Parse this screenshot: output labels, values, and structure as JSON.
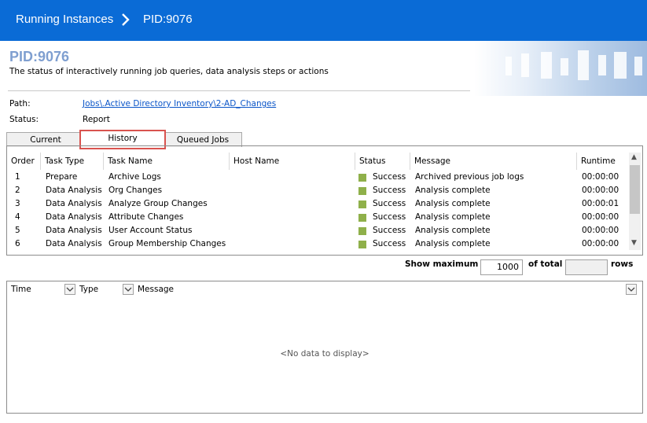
{
  "topbar": {
    "crumb_parent": "Running Instances",
    "crumb_current": "PID:9076"
  },
  "header": {
    "title": "PID:9076",
    "subtitle": "The status of interactively running job queries, data analysis steps or actions"
  },
  "info": {
    "path_label": "Path:",
    "path_value": "Jobs\\.Active Directory Inventory\\2-AD_Changes",
    "status_label": "Status:",
    "status_value": "Report"
  },
  "tabs": [
    {
      "label": "Current"
    },
    {
      "label": "History",
      "active": true
    },
    {
      "label": "Queued Jobs"
    }
  ],
  "table": {
    "columns": [
      "Order",
      "Task Type",
      "Task Name",
      "Host Name",
      "Status",
      "Message",
      "Runtime"
    ],
    "rows": [
      {
        "order": "1",
        "task_type": "Prepare",
        "task_name": "Archive Logs",
        "host": "",
        "status": "Success",
        "message": "Archived previous job logs",
        "runtime": "00:00:00"
      },
      {
        "order": "2",
        "task_type": "Data Analysis",
        "task_name": "Org Changes",
        "host": "",
        "status": "Success",
        "message": "Analysis complete",
        "runtime": "00:00:00"
      },
      {
        "order": "3",
        "task_type": "Data Analysis",
        "task_name": "Analyze Group Changes",
        "host": "",
        "status": "Success",
        "message": "Analysis complete",
        "runtime": "00:00:01"
      },
      {
        "order": "4",
        "task_type": "Data Analysis",
        "task_name": "Attribute Changes",
        "host": "",
        "status": "Success",
        "message": "Analysis complete",
        "runtime": "00:00:00"
      },
      {
        "order": "5",
        "task_type": "Data Analysis",
        "task_name": "User Account Status",
        "host": "",
        "status": "Success",
        "message": "Analysis complete",
        "runtime": "00:00:00"
      },
      {
        "order": "6",
        "task_type": "Data Analysis",
        "task_name": "Group Membership Changes",
        "host": "",
        "status": "Success",
        "message": "Analysis complete",
        "runtime": "00:00:00"
      }
    ],
    "status_color": "#8fb04a"
  },
  "maxrows": {
    "show_label": "Show maximum",
    "value": "1000",
    "of_total_label": "of total",
    "total_value": "",
    "rows_label": "rows"
  },
  "log": {
    "col_time": "Time",
    "col_type": "Type",
    "col_message": "Message",
    "empty_text": "<No data to display>"
  },
  "colors": {
    "topbar": "#0a6bd6",
    "title": "#7f9fd0",
    "link": "#0a55c8",
    "tab_highlight": "#d9534f"
  }
}
